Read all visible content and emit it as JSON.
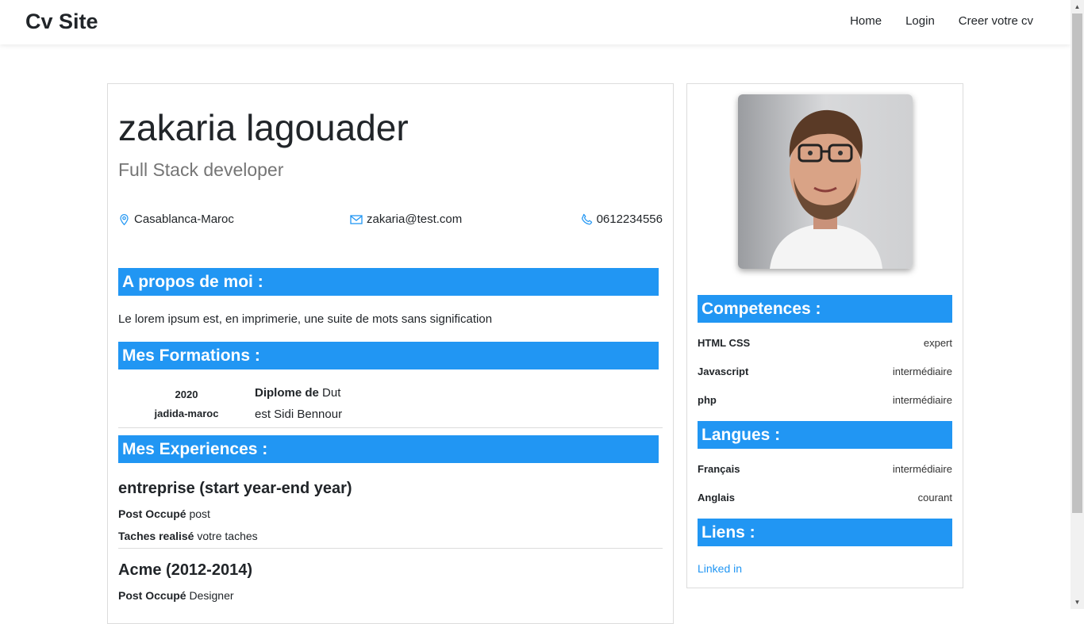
{
  "nav": {
    "brand": "Cv Site",
    "links": [
      "Home",
      "Login",
      "Creer votre cv"
    ]
  },
  "progress": {
    "fraction": 0.2
  },
  "profile": {
    "name": "zakaria lagouader",
    "role": "Full Stack developer",
    "location": "Casablanca-Maroc",
    "email": "zakaria@test.com",
    "phone": "0612234556",
    "photo_icon": "person-photo"
  },
  "about": {
    "heading": "A propos de moi :",
    "text": "Le lorem ipsum est, en imprimerie, une suite de mots sans signification"
  },
  "formations": {
    "heading": "Mes Formations :",
    "items": [
      {
        "year": "2020",
        "place": "jadida-maroc",
        "title_label": "Diplome de",
        "title_value": "Dut",
        "school": "est Sidi Bennour"
      }
    ]
  },
  "experiences": {
    "heading": "Mes Experiences :",
    "post_label": "Post Occupé",
    "tasks_label": "Taches realisé",
    "items": [
      {
        "title": "entreprise (start year-end year)",
        "post": "post",
        "tasks": "votre taches"
      },
      {
        "title": "Acme (2012-2014)",
        "post": "Designer"
      }
    ]
  },
  "competences": {
    "heading": "Competences :",
    "items": [
      {
        "name": "HTML CSS",
        "level": "expert"
      },
      {
        "name": "Javascript",
        "level": "intermédiaire"
      },
      {
        "name": "php",
        "level": "intermédiaire"
      }
    ]
  },
  "langues": {
    "heading": "Langues :",
    "items": [
      {
        "name": "Français",
        "level": "intermédiaire"
      },
      {
        "name": "Anglais",
        "level": "courant"
      }
    ]
  },
  "liens": {
    "heading": "Liens :",
    "items": [
      "Linked in"
    ]
  },
  "colors": {
    "accent": "#2196f3",
    "text": "#212529",
    "muted": "#757575"
  },
  "icons": {
    "location": "map-marker-icon",
    "email": "envelope-icon",
    "phone": "phone-icon"
  }
}
